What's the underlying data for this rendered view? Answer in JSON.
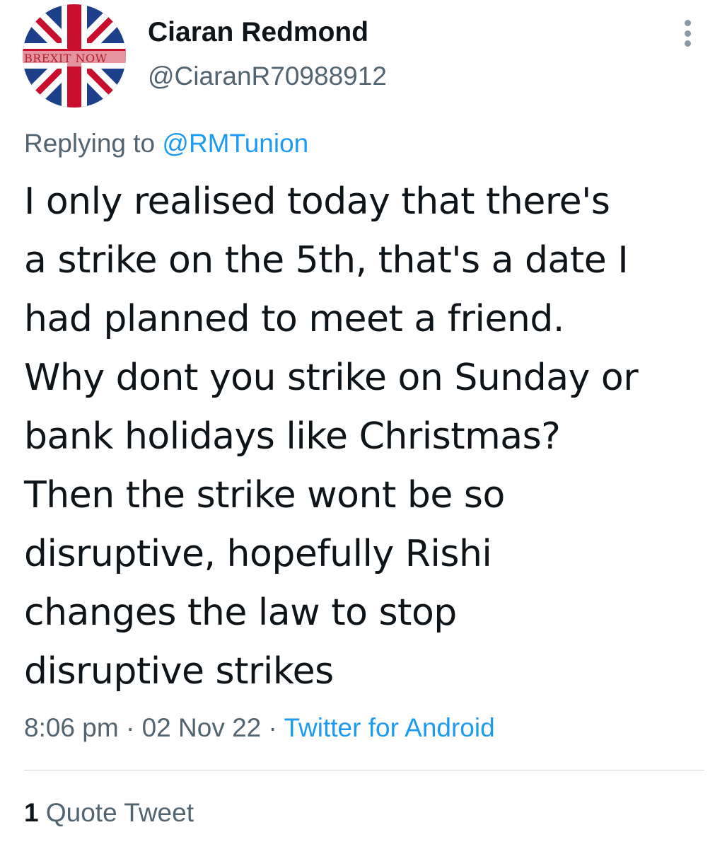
{
  "author": {
    "avatar_banner_text": "BREXIT NOW",
    "display_name": "Ciaran Redmond",
    "handle": "@CiaranR70988912"
  },
  "header": {
    "more_icon": "more-vertical-icon"
  },
  "reply": {
    "prefix": "Replying to",
    "mention": "@RMTunion"
  },
  "tweet": {
    "lines": [
      "I only realised today that there's",
      "a strike on the 5th, that's a date I",
      "had planned to meet a friend.",
      "Why dont you strike on Sunday or",
      "bank holidays like Christmas?",
      "Then the strike wont be so",
      "disruptive, hopefully Rishi",
      "changes the law to stop",
      "disruptive strikes"
    ]
  },
  "meta": {
    "time": "8:06 pm",
    "separator": " · ",
    "date": "02 Nov 22",
    "source": "Twitter for Android"
  },
  "stats": {
    "quote_count": "1",
    "quote_label": "Quote Tweet"
  },
  "colors": {
    "text_primary": "#0f1419",
    "text_secondary": "#536471",
    "link": "#1d9bf0",
    "divider": "#cfd9de"
  }
}
